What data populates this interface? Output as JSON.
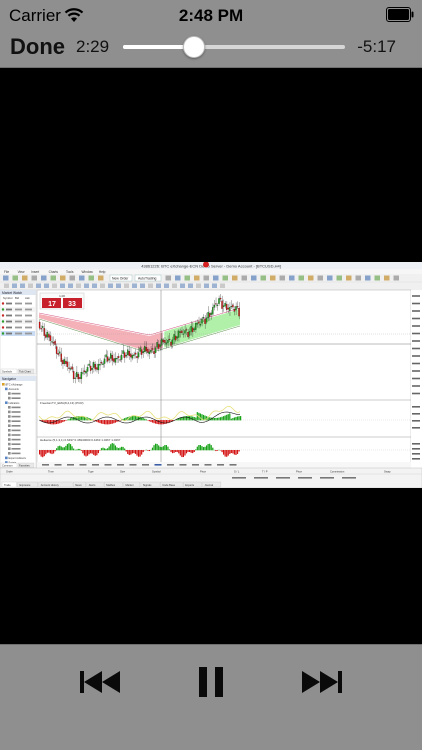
{
  "status_bar": {
    "carrier": "Carrier",
    "time": "2:48 PM"
  },
  "player": {
    "done_label": "Done",
    "elapsed": "2:29",
    "remaining": "-5:17",
    "progress_fraction": 0.32
  },
  "video": {
    "window_title": "43861226: BTC eXchange-ECN Demo Server - Demo Account - [BTCUSD,H4]",
    "menu_items": [
      "File",
      "View",
      "Insert",
      "Charts",
      "Tools",
      "Window",
      "Help"
    ],
    "toolbar": {
      "new_order": "New Order",
      "autotrading": "AutoTrading"
    },
    "market_watch": {
      "title": "Market Watch",
      "columns": [
        "Symbol",
        "Bid",
        "Ask"
      ],
      "tabs": [
        "Symbols",
        "Tick Chart"
      ]
    },
    "navigator": {
      "title": "Navigator",
      "items": [
        "BTC eXchange",
        "Accounts",
        "Indicators",
        "Expert Advisors",
        "Scripts"
      ],
      "tabs": [
        "Common",
        "Favorites"
      ]
    },
    "order_panel": {
      "sell_price": "17",
      "buy_price": "33",
      "lot": "1.00"
    },
    "indicator_labels": [
      "FreedomTV_EMA(8,2,13) (PCR)",
      "Heikenie (5,1,3,1) 0.6497 0.46940000 0.4463 1.0467 1.0467"
    ],
    "terminal_tabs": [
      "Trade",
      "Exposure",
      "Account History",
      "News",
      "Alerts",
      "Mailbox",
      "Market",
      "Signals",
      "Code Base",
      "Experts",
      "Journal"
    ],
    "terminal_columns": [
      "Order",
      "Time",
      "Type",
      "Size",
      "Symbol",
      "Price",
      "S / L",
      "T / P",
      "Price",
      "Commission",
      "Swap"
    ]
  },
  "colors": {
    "bar_bg": "#8f8f8f",
    "cloud_red": "#f4a9b0",
    "cloud_green": "#a8eea0",
    "candle_red": "#d41414",
    "candle_green": "#19a319",
    "macd_yellow": "#e8e07a"
  },
  "icons": {
    "wifi": "wifi-icon",
    "battery": "battery-icon",
    "previous": "skip-back-icon",
    "pause": "pause-icon",
    "next": "skip-forward-icon"
  }
}
